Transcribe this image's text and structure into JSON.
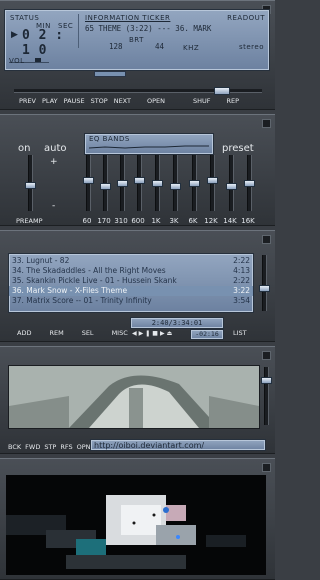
{
  "player": {
    "status_label": "STATUS",
    "min_label": "MIN",
    "sec_label": "SEC",
    "time": "0 2 : 1 0",
    "ticker_label": "INFORMATION TICKER",
    "readout_label": "READOUT",
    "ticker_text": "65 THEME (3:22)  ---  36. MARK",
    "bitrate_label": "BRT",
    "bitrate": "128",
    "khz": "44",
    "khz_label": "KHZ",
    "stereo": "stereo",
    "vol_label": "VOL",
    "controls": [
      "PREV",
      "PLAY",
      "PAUSE",
      "STOP",
      "NEXT",
      "OPEN",
      "SHUF",
      "REP"
    ]
  },
  "equalizer": {
    "on_label": "on",
    "auto_label": "auto",
    "preset_label": "preset",
    "graph_label": "EQ BANDS",
    "preamp_label": "PREAMP",
    "bands": [
      "60",
      "170",
      "310",
      "600",
      "1K",
      "3K",
      "6K",
      "12K",
      "14K",
      "16K"
    ],
    "levels": [
      0.55,
      0.45,
      0.5,
      0.55,
      0.5,
      0.45,
      0.5,
      0.55,
      0.45,
      0.5
    ],
    "preamp_level": 0.5,
    "plus_label": "+",
    "minus_label": "-"
  },
  "playlist": {
    "items": [
      {
        "title": "33. Lugnut - 82",
        "length": "2:22"
      },
      {
        "title": "34. The Skadaddles - All the Right Moves",
        "length": "4:13"
      },
      {
        "title": "35. Skankin Pickle Live - 01 - Hussein Skank",
        "length": "2:22"
      },
      {
        "title": "36. Mark Snow - X-Files Theme",
        "length": "3:22"
      },
      {
        "title": "37. Matrix Score -- 01 - Trinity Infinity",
        "length": "3:54"
      }
    ],
    "selected_index": 3,
    "buttons": [
      "ADD",
      "REM",
      "SEL",
      "MISC"
    ],
    "list_button": "LIST",
    "time_display": "2:40/3:34:01",
    "mini_display": "-02:16"
  },
  "browser": {
    "buttons": [
      "BCK",
      "FWD",
      "STP",
      "RFS",
      "OPN"
    ],
    "url": "http://oiboi.deviantart.com/"
  }
}
